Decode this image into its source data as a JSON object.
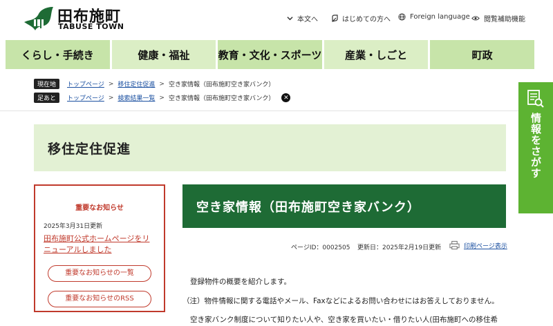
{
  "header": {
    "site_name": "田布施町",
    "site_sub": "TABUSE TOWN",
    "utility": {
      "to_body": "本文へ",
      "first_time": "はじめての方へ",
      "foreign": "Foreign language",
      "assist": "閲覧補助機能"
    }
  },
  "gnav": [
    {
      "label": "くらし・手続き"
    },
    {
      "label": "健康・福祉"
    },
    {
      "label": "教育・文化・スポーツ"
    },
    {
      "label": "産業・しごと"
    },
    {
      "label": "町政"
    }
  ],
  "side_tab": {
    "label": "情報をさがす"
  },
  "breadcrumb_current": {
    "tag": "現在地",
    "items": [
      "トップページ",
      "移住定住促進",
      "空き家情報（田布施町空き家バンク）"
    ]
  },
  "breadcrumb_trail": {
    "tag": "足あと",
    "items": [
      "トップページ",
      "検索結果一覧",
      "空き家情報（田布施町空き家バンク）"
    ]
  },
  "category_title": "移住定住促進",
  "notice": {
    "heading": "重要なお知らせ",
    "date": "2025年3月31日更新",
    "link": "田布施町公式ホームページをリニューアルしました",
    "btn_list": "重要なお知らせの一覧",
    "btn_rss": "重要なお知らせのRSS"
  },
  "page": {
    "title": "空き家情報（田布施町空き家バンク）",
    "page_id": "ページID：0002505",
    "updated": "更新日：2025年2月19日更新",
    "print": "印刷ページ表示",
    "para1": "登録物件の概要を紹介します。",
    "para2": "（注）物件情報に関する電話やメール、Faxなどによるお問い合わせにはお答えしておりません。",
    "para3": "空き家バンク制度について知りたい人や、空き家を買いたい・借りたい人(田布施町への移住希"
  },
  "colors": {
    "brand_green": "#1e6b35",
    "nav_green": "#c7e4a9",
    "side_tab_green": "#5db332",
    "notice_red": "#c0392b"
  }
}
